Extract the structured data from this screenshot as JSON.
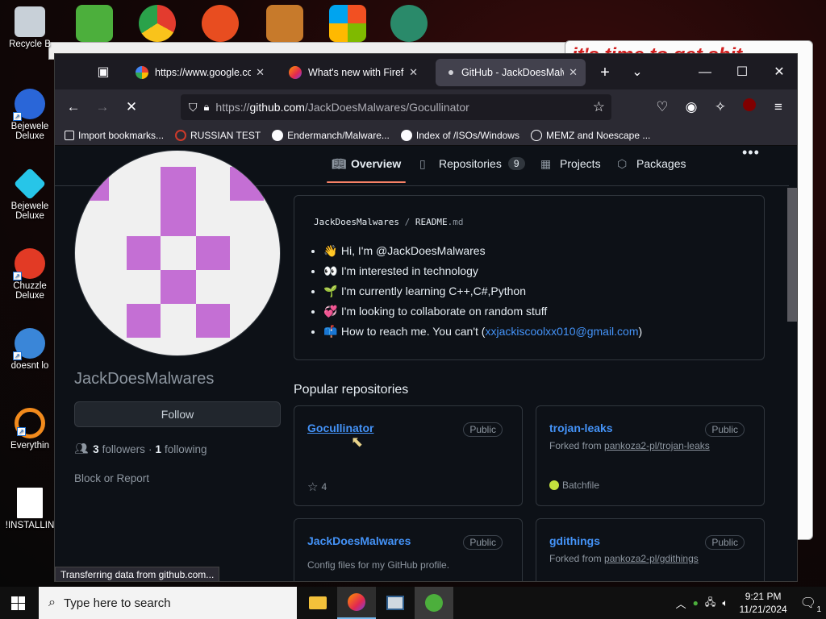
{
  "desktop": {
    "icons": [
      {
        "label": "Recycle B"
      },
      {
        "label": "Bejewele Deluxe"
      },
      {
        "label": "Bejewele Deluxe"
      },
      {
        "label": "Chuzzle Deluxe"
      },
      {
        "label": "doesnt lo"
      },
      {
        "label": "Everythin"
      },
      {
        "label": "!INSTALLIN"
      }
    ],
    "background_banner": "it's time to get shit"
  },
  "browser": {
    "tabs": [
      {
        "title": "https://www.google.com",
        "active": false
      },
      {
        "title": "What's new with Firefox",
        "active": false
      },
      {
        "title": "GitHub - JackDoesMalwares",
        "active": true
      }
    ],
    "url_prefix": "https://",
    "url_host": "github.com",
    "url_path": "/JackDoesMalwares/Gocullinator",
    "bookmarks": [
      "Import bookmarks...",
      "RUSSIAN TEST",
      "Endermanch/Malware...",
      "Index of /ISOs/Windows",
      "MEMZ and Noescape ..."
    ],
    "status_text": "Transferring data from github.com..."
  },
  "github": {
    "nav": [
      {
        "label": "Overview",
        "selected": true
      },
      {
        "label": "Repositories",
        "count": "9"
      },
      {
        "label": "Projects"
      },
      {
        "label": "Packages"
      }
    ],
    "username": "JackDoesMalwares",
    "follow_label": "Follow",
    "followers_count": "3",
    "followers_label": "followers",
    "following_count": "1",
    "following_label": "following",
    "block_label": "Block or Report",
    "readme_user": "JackDoesMalwares",
    "readme_sep": "/",
    "readme_file": "README",
    "readme_ext": ".md",
    "readme_items": [
      {
        "emoji": "👋",
        "text": "Hi, I'm @JackDoesMalwares"
      },
      {
        "emoji": "👀",
        "text": "I'm interested in technology"
      },
      {
        "emoji": "🌱",
        "text": "I'm currently learning C++,C#,Python"
      },
      {
        "emoji": "💞",
        "text": "I'm looking to collaborate on random stuff"
      },
      {
        "emoji": "📫",
        "text": "How to reach me. You can't ("
      }
    ],
    "readme_email": "xxjackiscoolxx010@gmail.com",
    "readme_close": ")",
    "popular_title": "Popular repositories",
    "repos": [
      {
        "name": "Gocullinator",
        "badge": "Public",
        "stars": "4"
      },
      {
        "name": "trojan-leaks",
        "badge": "Public",
        "fork_prefix": "Forked from",
        "fork_source": "pankoza2-pl/trojan-leaks",
        "language": "Batchfile"
      },
      {
        "name": "JackDoesMalwares",
        "badge": "Public",
        "description": "Config files for my GitHub profile."
      },
      {
        "name": "gdithings",
        "badge": "Public",
        "fork_prefix": "Forked from",
        "fork_source": "pankoza2-pl/gdithings"
      }
    ]
  },
  "taskbar": {
    "search_placeholder": "Type here to search",
    "time": "9:21 PM",
    "date": "11/21/2024",
    "notification_count": "1"
  }
}
